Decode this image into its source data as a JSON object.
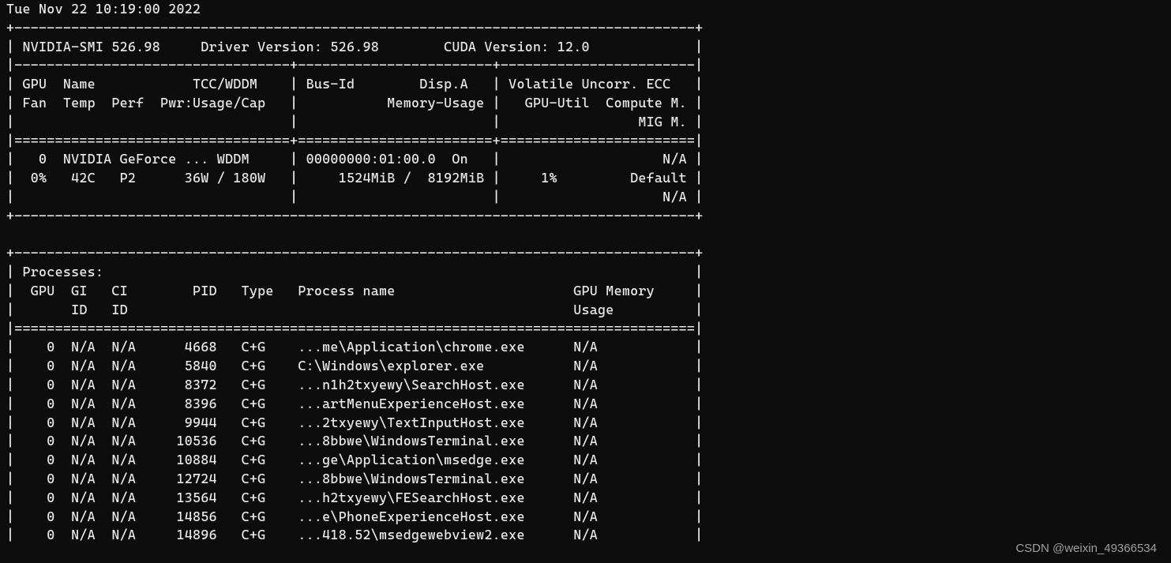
{
  "timestamp": "Tue Nov 22 10:19:00 2022",
  "smi_version": "526.98",
  "driver_version": "526.98",
  "cuda_version": "12.0",
  "gpu_headers": {
    "line1_left": "GPU  Name            TCC/WDDM",
    "line1_mid": "Bus-Id        Disp.A",
    "line1_right": "Volatile Uncorr. ECC",
    "line2_left": "Fan  Temp  Perf  Pwr:Usage/Cap",
    "line2_mid": "Memory-Usage",
    "line2_right": "GPU-Util  Compute M.",
    "line3_right": "MIG M."
  },
  "gpu": {
    "index": "0",
    "name": "NVIDIA GeForce ...",
    "mode": "WDDM",
    "bus_id": "00000000:01:00.0",
    "disp_a": "On",
    "ecc": "N/A",
    "fan": "0%",
    "temp": "42C",
    "perf": "P2",
    "pwr": "36W / 180W",
    "mem_used": "1524MiB",
    "mem_total": "8192MiB",
    "util": "1%",
    "compute_mode": "Default",
    "mig_mode": "N/A"
  },
  "proc_section_title": "Processes:",
  "proc_headers": {
    "gpu": "GPU",
    "gi": "GI",
    "ci": "CI",
    "pid": "PID",
    "type": "Type",
    "name": "Process name",
    "mem": "GPU Memory",
    "gi2": "ID",
    "ci2": "ID",
    "mem2": "Usage"
  },
  "processes": [
    {
      "gpu": "0",
      "gi": "N/A",
      "ci": "N/A",
      "pid": "4668",
      "type": "C+G",
      "name": "...me\\Application\\chrome.exe",
      "mem": "N/A"
    },
    {
      "gpu": "0",
      "gi": "N/A",
      "ci": "N/A",
      "pid": "5840",
      "type": "C+G",
      "name": "C:\\Windows\\explorer.exe",
      "mem": "N/A"
    },
    {
      "gpu": "0",
      "gi": "N/A",
      "ci": "N/A",
      "pid": "8372",
      "type": "C+G",
      "name": "...n1h2txyewy\\SearchHost.exe",
      "mem": "N/A"
    },
    {
      "gpu": "0",
      "gi": "N/A",
      "ci": "N/A",
      "pid": "8396",
      "type": "C+G",
      "name": "...artMenuExperienceHost.exe",
      "mem": "N/A"
    },
    {
      "gpu": "0",
      "gi": "N/A",
      "ci": "N/A",
      "pid": "9944",
      "type": "C+G",
      "name": "...2txyewy\\TextInputHost.exe",
      "mem": "N/A"
    },
    {
      "gpu": "0",
      "gi": "N/A",
      "ci": "N/A",
      "pid": "10536",
      "type": "C+G",
      "name": "...8bbwe\\WindowsTerminal.exe",
      "mem": "N/A"
    },
    {
      "gpu": "0",
      "gi": "N/A",
      "ci": "N/A",
      "pid": "10884",
      "type": "C+G",
      "name": "...ge\\Application\\msedge.exe",
      "mem": "N/A"
    },
    {
      "gpu": "0",
      "gi": "N/A",
      "ci": "N/A",
      "pid": "12724",
      "type": "C+G",
      "name": "...8bbwe\\WindowsTerminal.exe",
      "mem": "N/A"
    },
    {
      "gpu": "0",
      "gi": "N/A",
      "ci": "N/A",
      "pid": "13564",
      "type": "C+G",
      "name": "...h2txyewy\\FESearchHost.exe",
      "mem": "N/A"
    },
    {
      "gpu": "0",
      "gi": "N/A",
      "ci": "N/A",
      "pid": "14856",
      "type": "C+G",
      "name": "...e\\PhoneExperienceHost.exe",
      "mem": "N/A"
    },
    {
      "gpu": "0",
      "gi": "N/A",
      "ci": "N/A",
      "pid": "14896",
      "type": "C+G",
      "name": "...418.52\\msedgewebview2.exe",
      "mem": "N/A"
    }
  ],
  "watermark": "CSDN @weixin_49366534"
}
